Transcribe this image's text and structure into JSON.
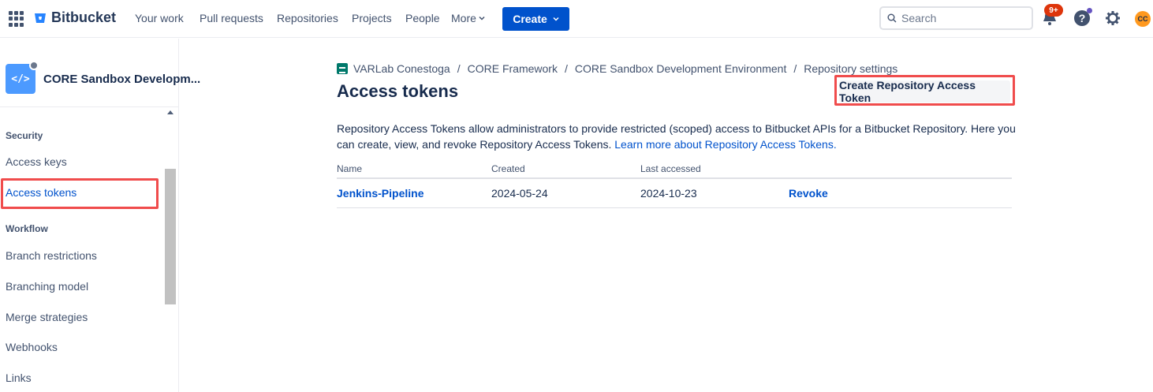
{
  "topnav": {
    "logo_text": "Bitbucket",
    "items": [
      "Your work",
      "Pull requests",
      "Repositories",
      "Projects",
      "People"
    ],
    "more_label": "More",
    "create_label": "Create",
    "search_placeholder": "Search",
    "notifications_badge": "9+",
    "avatar_initials": "CC"
  },
  "sidebar": {
    "repo_name": "CORE Sandbox Developm...",
    "repo_avatar_glyph": "</>",
    "sections": [
      {
        "title": "Security",
        "items": [
          "Access keys",
          "Access tokens"
        ]
      },
      {
        "title": "Workflow",
        "items": [
          "Branch restrictions",
          "Branching model",
          "Merge strategies",
          "Webhooks",
          "Links"
        ]
      }
    ],
    "active_item": "Access tokens"
  },
  "breadcrumbs": [
    "VARLab Conestoga",
    "CORE Framework",
    "CORE Sandbox Development Environment",
    "Repository settings"
  ],
  "page": {
    "title": "Access tokens",
    "create_button": "Create Repository Access Token",
    "description": "Repository Access Tokens allow administrators to provide restricted (scoped) access to Bitbucket APIs for a Bitbucket Repository. Here you can create, view, and revoke Repository Access Tokens.",
    "learn_more": "Learn more about Repository Access Tokens."
  },
  "table": {
    "columns": [
      "Name",
      "Created",
      "Last accessed"
    ],
    "rows": [
      {
        "name": "Jenkins-Pipeline",
        "created": "2024-05-24",
        "last_accessed": "2024-10-23",
        "action": "Revoke"
      }
    ]
  },
  "colors": {
    "brand": "#0052cc",
    "highlight": "#f04c4c",
    "badge": "#de350b",
    "avatar": "#ff991f"
  }
}
